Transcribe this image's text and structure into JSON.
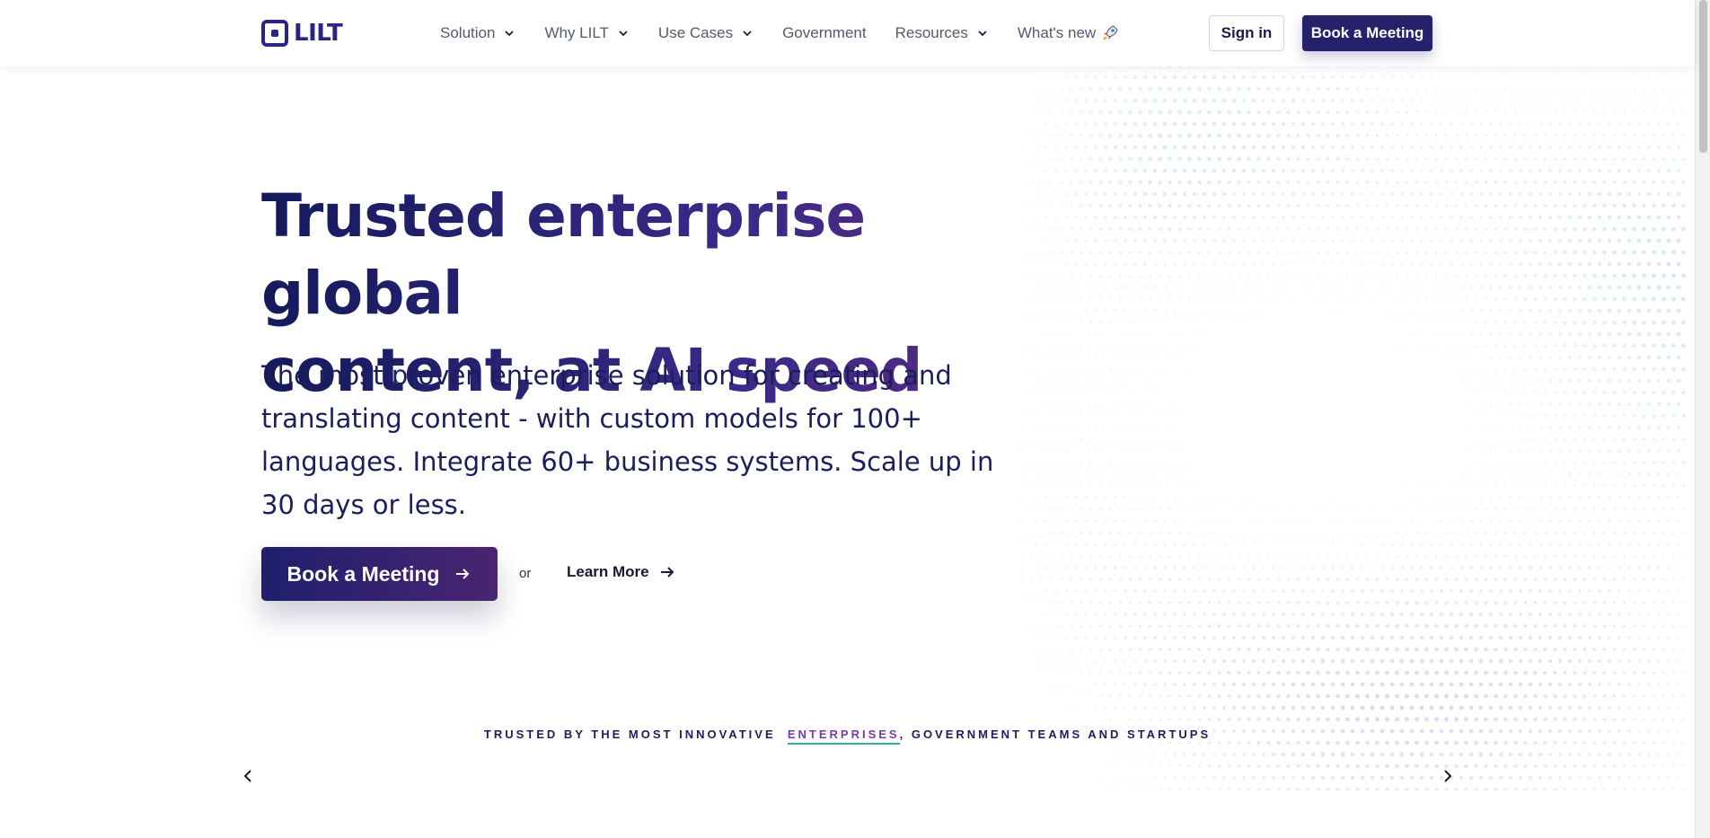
{
  "header": {
    "logo_text": "LILT",
    "nav": [
      {
        "label": "Solution",
        "has_dropdown": true
      },
      {
        "label": "Why LILT",
        "has_dropdown": true
      },
      {
        "label": "Use Cases",
        "has_dropdown": true
      },
      {
        "label": "Government",
        "has_dropdown": false
      },
      {
        "label": "Resources",
        "has_dropdown": true
      },
      {
        "label": "What's new",
        "has_dropdown": false,
        "icon": "rocket-icon"
      }
    ],
    "sign_in_label": "Sign in",
    "book_meeting_label": "Book a Meeting"
  },
  "hero": {
    "title_line1": "Trusted enterprise global",
    "title_line2": "content, at AI speed",
    "subtitle": "The most proven enterprise solution for creating and translating content - with custom models for 100+ languages. Integrate 60+ business systems. Scale up in 30 days or less.",
    "cta_label": "Book a Meeting",
    "or_text": "or",
    "learn_more_label": "Learn More"
  },
  "trusted": {
    "prefix": "TRUSTED BY THE MOST INNOVATIVE",
    "highlight": "ENTERPRISES",
    "suffix": ", GOVERNMENT TEAMS AND STARTUPS"
  },
  "colors": {
    "brand": "#25216a",
    "accent_purple": "#7a3aa8",
    "accent_teal": "#2bb5a0"
  }
}
